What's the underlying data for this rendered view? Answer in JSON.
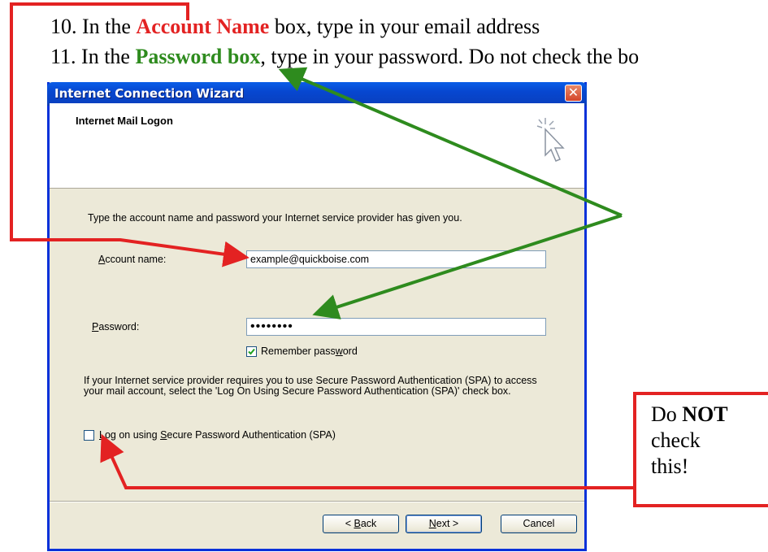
{
  "instructions": {
    "step10": {
      "prefix": "10. In the ",
      "highlight": "Account Name",
      "suffix": " box, type in your email address"
    },
    "step11": {
      "prefix": "11. In the ",
      "highlight": "Password box",
      "suffix": ", type in your password. Do not check the bo"
    }
  },
  "dialog": {
    "title": "Internet Connection Wizard",
    "close_glyph": "✕",
    "heading": "Internet Mail Logon",
    "description": "Type the account name and password your Internet service provider has given you.",
    "account_label_first": "A",
    "account_label_rest": "ccount name:",
    "account_value": "example@quickboise.com",
    "password_label_first": "P",
    "password_label_rest": "assword:",
    "password_value": "••••••••",
    "remember_label_pre": "Remember pass",
    "remember_label_u": "w",
    "remember_label_post": "ord",
    "remember_checked": true,
    "spa_text": "If your Internet service provider requires you to use Secure Password Authentication (SPA) to access your mail account, select the 'Log On Using Secure Password Authentication (SPA)' check box.",
    "spa_label_u1": "L",
    "spa_label_mid": "og on using ",
    "spa_label_u2": "S",
    "spa_label_post": "ecure Password Authentication (SPA)",
    "spa_checked": false,
    "buttons": {
      "back_pre": "< ",
      "back_u": "B",
      "back_post": "ack",
      "next_u": "N",
      "next_post": "ext >",
      "cancel": "Cancel"
    }
  },
  "callout": {
    "pre": "Do ",
    "strong": "NOT",
    "line2": "check",
    "line3": "this!"
  },
  "colors": {
    "red_annotation": "#e32222",
    "green_annotation": "#2e8b1e",
    "xp_title_blue": "#0a5ee8",
    "dialog_bg": "#ece9d8"
  }
}
